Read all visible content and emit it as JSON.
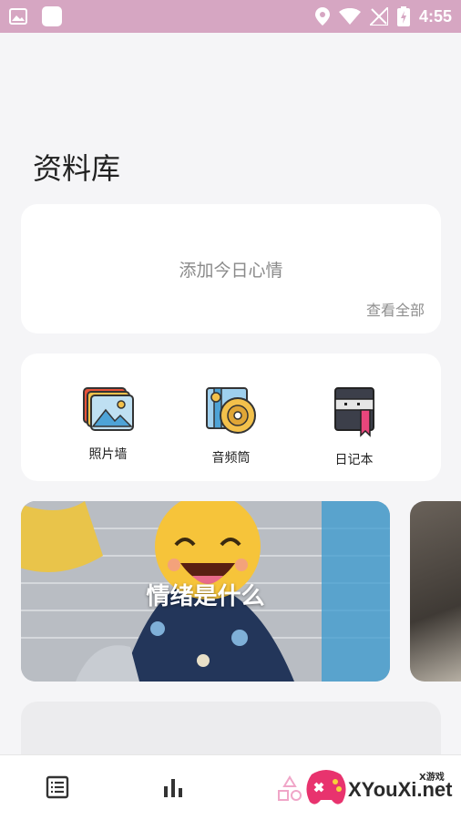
{
  "status_bar": {
    "time": "4:55"
  },
  "page": {
    "title": "资料库"
  },
  "mood_card": {
    "add_label": "添加今日心情",
    "view_all_label": "查看全部"
  },
  "features": [
    {
      "label": "照片墙",
      "icon": "photo-wall-icon"
    },
    {
      "label": "音频筒",
      "icon": "audio-disc-icon"
    },
    {
      "label": "日记本",
      "icon": "diary-book-icon"
    }
  ],
  "banner": {
    "title": "情绪是什么"
  },
  "bottom_nav": [
    {
      "icon": "list-icon"
    },
    {
      "icon": "bar-chart-icon"
    },
    {
      "icon": "shapes-icon"
    }
  ],
  "watermark": {
    "text": "XYouXi.net",
    "sub": "X游戏"
  },
  "colors": {
    "status_bar": "#d6a6c2",
    "background": "#f5f5f7",
    "card": "#ffffff"
  }
}
